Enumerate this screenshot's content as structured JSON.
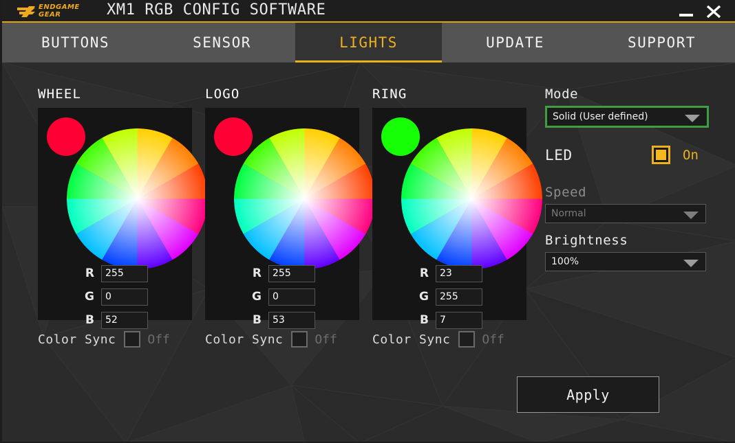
{
  "window": {
    "title": "XM1 RGB CONFIG SOFTWARE",
    "logo_line1": "ENDGAME",
    "logo_line2": "GEAR",
    "minimize_label": "Minimize",
    "close_label": "Close",
    "accent_yellow": "#efb01e",
    "titlebar_bg": "#1e1e1e",
    "body_bg": "#2b2b2b",
    "focus_green": "#3f9e3f"
  },
  "tabs": [
    {
      "label": "BUTTONS",
      "active": false
    },
    {
      "label": "SENSOR",
      "active": false
    },
    {
      "label": "LIGHTS",
      "active": true
    },
    {
      "label": "UPDATE",
      "active": false
    },
    {
      "label": "SUPPORT",
      "active": false
    }
  ],
  "channels": [
    {
      "title": "WHEEL",
      "swatch_color": "#ff0034",
      "r_label": "R",
      "g_label": "G",
      "b_label": "B",
      "r": "255",
      "g": "0",
      "b": "52",
      "sync_label": "Color Sync",
      "sync_state": "Off",
      "sync_checked": false
    },
    {
      "title": "LOGO",
      "swatch_color": "#ff0035",
      "r_label": "R",
      "g_label": "G",
      "b_label": "B",
      "r": "255",
      "g": "0",
      "b": "53",
      "sync_label": "Color Sync",
      "sync_state": "Off",
      "sync_checked": false
    },
    {
      "title": "RING",
      "swatch_color": "#17ff07",
      "r_label": "R",
      "g_label": "G",
      "b_label": "B",
      "r": "23",
      "g": "255",
      "b": "7",
      "sync_label": "Color Sync",
      "sync_state": "Off",
      "sync_checked": false
    }
  ],
  "controls": {
    "mode_label": "Mode",
    "mode_value": "Solid (User defined)",
    "mode_focused": true,
    "led_label": "LED",
    "led_state": "On",
    "led_checked": true,
    "speed_label": "Speed",
    "speed_value": "Normal",
    "speed_disabled": true,
    "brightness_label": "Brightness",
    "brightness_value": "100%"
  },
  "apply": {
    "label": "Apply"
  }
}
